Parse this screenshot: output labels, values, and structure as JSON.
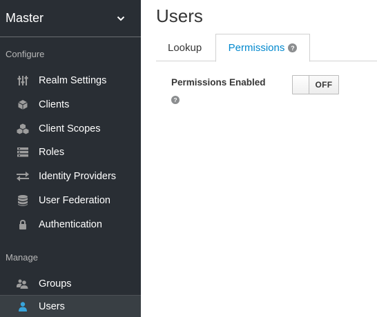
{
  "sidebar": {
    "realm": "Master",
    "sections": {
      "configure": "Configure",
      "manage": "Manage"
    },
    "configure_items": [
      {
        "label": "Realm Settings",
        "icon": "sliders-icon"
      },
      {
        "label": "Clients",
        "icon": "cube-icon"
      },
      {
        "label": "Client Scopes",
        "icon": "cubes-icon"
      },
      {
        "label": "Roles",
        "icon": "list-icon"
      },
      {
        "label": "Identity Providers",
        "icon": "exchange-icon"
      },
      {
        "label": "User Federation",
        "icon": "database-icon"
      },
      {
        "label": "Authentication",
        "icon": "lock-icon"
      }
    ],
    "manage_items": [
      {
        "label": "Groups",
        "icon": "users-icon"
      },
      {
        "label": "Users",
        "icon": "user-icon",
        "active": true
      }
    ]
  },
  "main": {
    "title": "Users",
    "tabs": [
      {
        "label": "Lookup",
        "active": false
      },
      {
        "label": "Permissions",
        "active": true,
        "help_icon": "?"
      }
    ],
    "permissions_enabled": {
      "label": "Permissions Enabled",
      "help_icon": "?",
      "toggle_text": "OFF",
      "value": false
    }
  },
  "colors": {
    "sidebar_bg": "#292e34",
    "active_tab": "#0088ce",
    "active_nav_icon": "#39a5dc"
  }
}
